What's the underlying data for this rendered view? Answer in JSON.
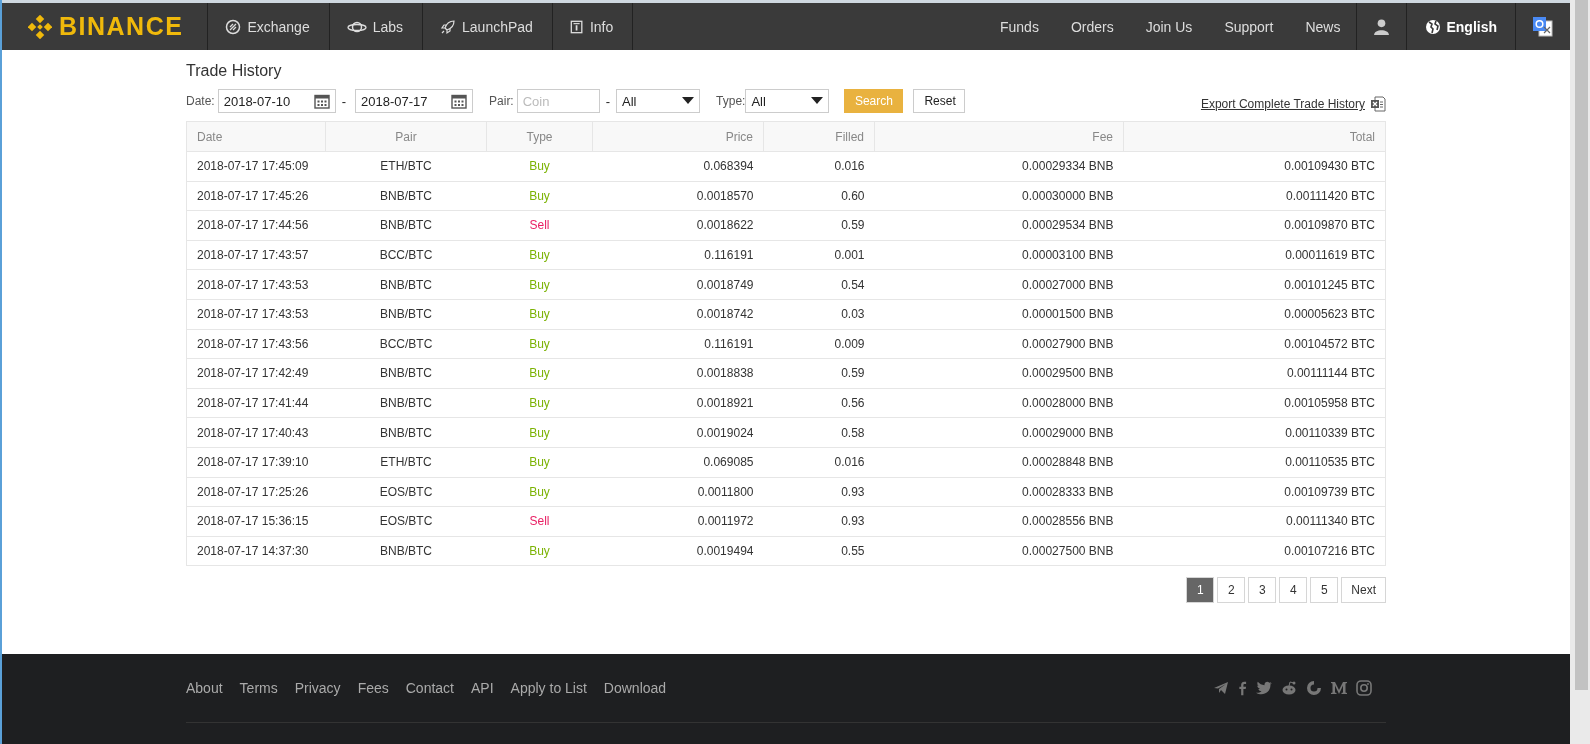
{
  "brand": "BINANCE",
  "nav_left": [
    {
      "label": "Exchange",
      "kind": "exchange"
    },
    {
      "label": "Labs",
      "kind": "labs"
    },
    {
      "label": "LaunchPad",
      "kind": "rocket"
    },
    {
      "label": "Info",
      "kind": "info"
    }
  ],
  "nav_right": [
    "Funds",
    "Orders",
    "Join Us",
    "Support",
    "News"
  ],
  "language": "English",
  "page_title": "Trade History",
  "filters": {
    "date_label": "Date:",
    "date_from": "2018-07-10",
    "date_sep": "-",
    "date_to": "2018-07-17",
    "pair_label": "Pair:",
    "coin_placeholder": "Coin",
    "pair_sep": "-",
    "quote_value": "All",
    "type_label": "Type:",
    "type_value": "All",
    "search_button": "Search",
    "reset_button": "Reset",
    "export_link": "Export Complete Trade History"
  },
  "table": {
    "columns": [
      "Date",
      "Pair",
      "Type",
      "Price",
      "Filled",
      "Fee",
      "Total"
    ],
    "rows": [
      {
        "date": "2018-07-17 17:45:09",
        "pair": "ETH/BTC",
        "type": "Buy",
        "kind": "buy",
        "price": "0.068394",
        "filled": "0.016",
        "fee": "0.00029334 BNB",
        "total": "0.00109430 BTC"
      },
      {
        "date": "2018-07-17 17:45:26",
        "pair": "BNB/BTC",
        "type": "Buy",
        "kind": "buy",
        "price": "0.0018570",
        "filled": "0.60",
        "fee": "0.00030000 BNB",
        "total": "0.00111420 BTC"
      },
      {
        "date": "2018-07-17 17:44:56",
        "pair": "BNB/BTC",
        "type": "Sell",
        "kind": "sell",
        "price": "0.0018622",
        "filled": "0.59",
        "fee": "0.00029534 BNB",
        "total": "0.00109870 BTC"
      },
      {
        "date": "2018-07-17 17:43:57",
        "pair": "BCC/BTC",
        "type": "Buy",
        "kind": "buy",
        "price": "0.116191",
        "filled": "0.001",
        "fee": "0.00003100 BNB",
        "total": "0.00011619 BTC"
      },
      {
        "date": "2018-07-17 17:43:53",
        "pair": "BNB/BTC",
        "type": "Buy",
        "kind": "buy",
        "price": "0.0018749",
        "filled": "0.54",
        "fee": "0.00027000 BNB",
        "total": "0.00101245 BTC"
      },
      {
        "date": "2018-07-17 17:43:53",
        "pair": "BNB/BTC",
        "type": "Buy",
        "kind": "buy",
        "price": "0.0018742",
        "filled": "0.03",
        "fee": "0.00001500 BNB",
        "total": "0.00005623 BTC"
      },
      {
        "date": "2018-07-17 17:43:56",
        "pair": "BCC/BTC",
        "type": "Buy",
        "kind": "buy",
        "price": "0.116191",
        "filled": "0.009",
        "fee": "0.00027900 BNB",
        "total": "0.00104572 BTC"
      },
      {
        "date": "2018-07-17 17:42:49",
        "pair": "BNB/BTC",
        "type": "Buy",
        "kind": "buy",
        "price": "0.0018838",
        "filled": "0.59",
        "fee": "0.00029500 BNB",
        "total": "0.00111144 BTC"
      },
      {
        "date": "2018-07-17 17:41:44",
        "pair": "BNB/BTC",
        "type": "Buy",
        "kind": "buy",
        "price": "0.0018921",
        "filled": "0.56",
        "fee": "0.00028000 BNB",
        "total": "0.00105958 BTC"
      },
      {
        "date": "2018-07-17 17:40:43",
        "pair": "BNB/BTC",
        "type": "Buy",
        "kind": "buy",
        "price": "0.0019024",
        "filled": "0.58",
        "fee": "0.00029000 BNB",
        "total": "0.00110339 BTC"
      },
      {
        "date": "2018-07-17 17:39:10",
        "pair": "ETH/BTC",
        "type": "Buy",
        "kind": "buy",
        "price": "0.069085",
        "filled": "0.016",
        "fee": "0.00028848 BNB",
        "total": "0.00110535 BTC"
      },
      {
        "date": "2018-07-17 17:25:26",
        "pair": "EOS/BTC",
        "type": "Buy",
        "kind": "buy",
        "price": "0.0011800",
        "filled": "0.93",
        "fee": "0.00028333 BNB",
        "total": "0.00109739 BTC"
      },
      {
        "date": "2018-07-17 15:36:15",
        "pair": "EOS/BTC",
        "type": "Sell",
        "kind": "sell",
        "price": "0.0011972",
        "filled": "0.93",
        "fee": "0.00028556 BNB",
        "total": "0.00111340 BTC"
      },
      {
        "date": "2018-07-17 14:37:30",
        "pair": "BNB/BTC",
        "type": "Buy",
        "kind": "buy",
        "price": "0.0019494",
        "filled": "0.55",
        "fee": "0.00027500 BNB",
        "total": "0.00107216 BTC"
      }
    ]
  },
  "pagination": [
    {
      "label": "1",
      "selected": true
    },
    {
      "label": "2",
      "selected": false
    },
    {
      "label": "3",
      "selected": false
    },
    {
      "label": "4",
      "selected": false
    },
    {
      "label": "5",
      "selected": false
    },
    {
      "label": "Next",
      "selected": false
    }
  ],
  "footer_links": [
    "About",
    "Terms",
    "Privacy",
    "Fees",
    "Contact",
    "API",
    "Apply to List",
    "Download"
  ]
}
